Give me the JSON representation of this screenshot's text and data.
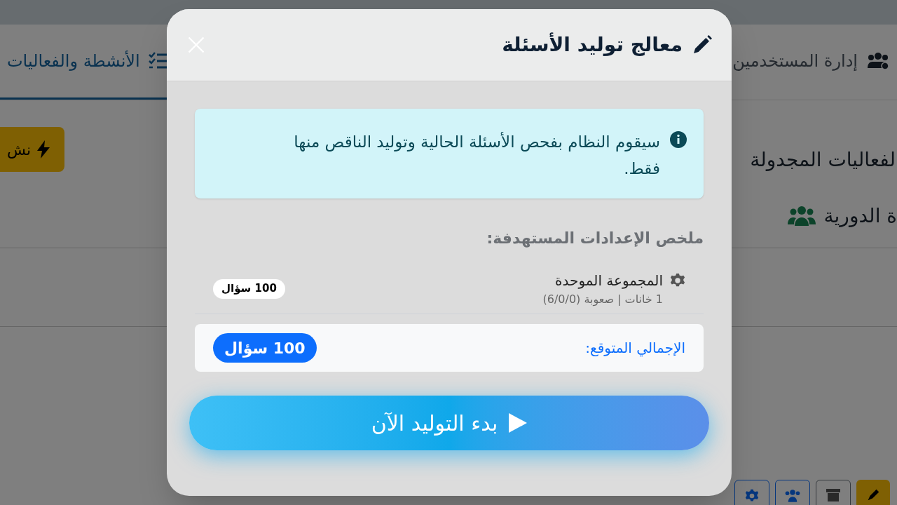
{
  "page": {
    "tabs": [
      {
        "label": "إدارة المستخدمين",
        "selected": false
      },
      {
        "label": "الأنشطة والفعاليات",
        "selected": true
      }
    ],
    "action_button": {
      "label": "نش"
    },
    "section_heading": "لفعاليات المجدولة",
    "group_heading": "ة الدورية"
  },
  "modal": {
    "title": "معالج توليد الأسئلة",
    "info": "سيقوم النظام بفحص الأسئلة الحالية وتوليد الناقص منها فقط.",
    "summary_label": "ملخص الإعدادات المستهدفة:",
    "items": [
      {
        "name": "المجموعة الموحدة",
        "meta": "1 خانات | صعوبة (6/0/0)",
        "count": "100 سؤال"
      }
    ],
    "total": {
      "label": "الإجمالي المتوقع:",
      "value": "100 سؤال"
    },
    "start_button": {
      "label": "بدء التوليد الآن"
    }
  }
}
